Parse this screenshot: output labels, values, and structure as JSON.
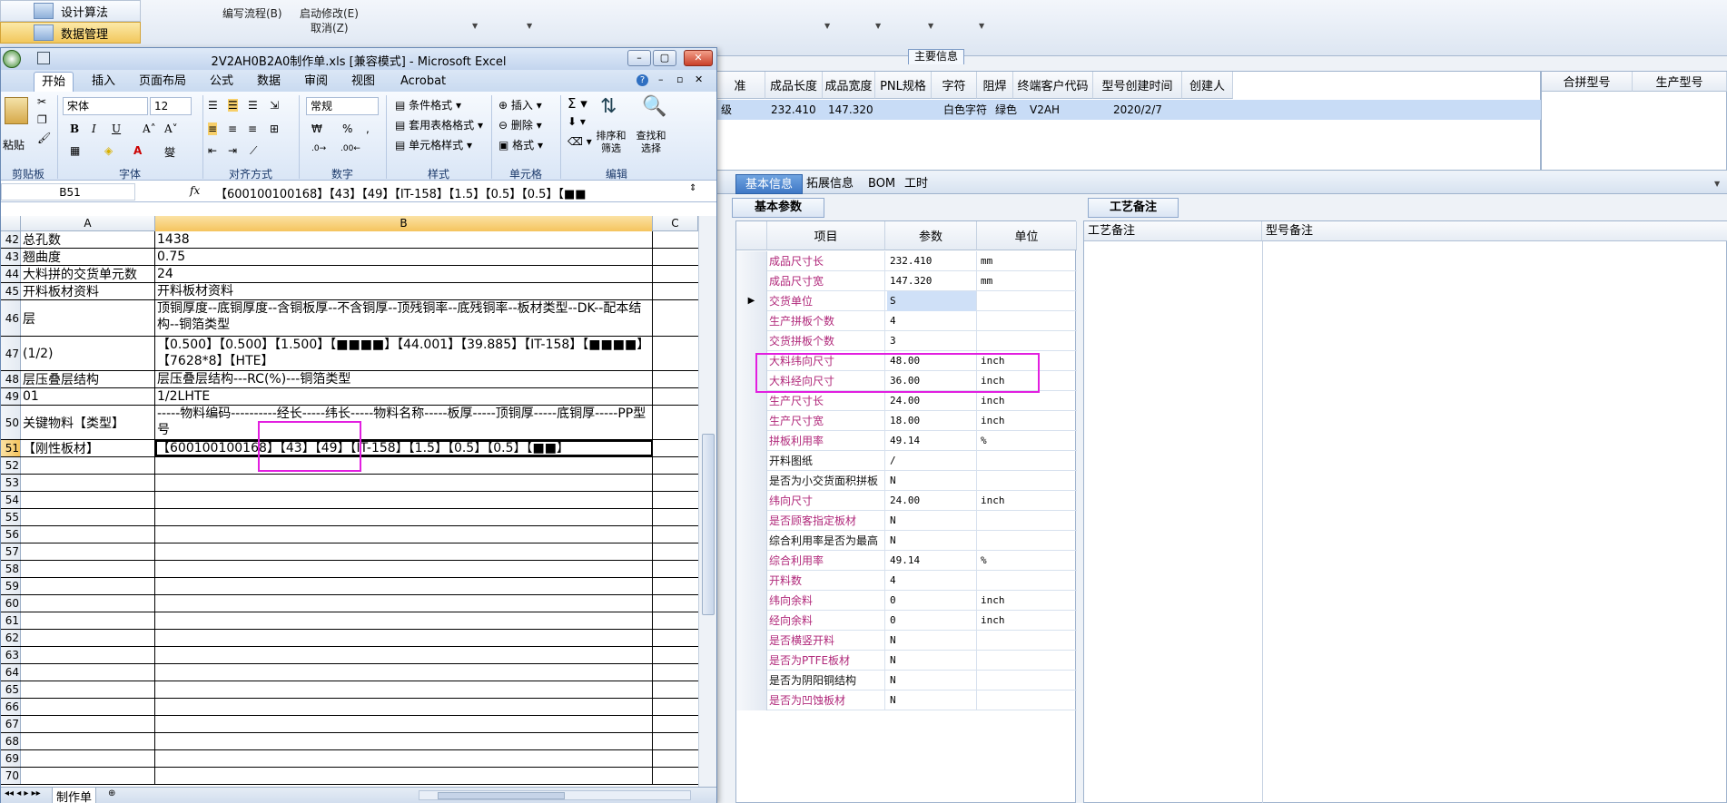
{
  "bg_app": {
    "side_items": [
      {
        "label": "设计算法"
      },
      {
        "label": "数据管理"
      }
    ],
    "ribbon": {
      "edit_flow": "编写流程(B)",
      "start_modify": "启动修改(E)",
      "cancel": "取消(Z)"
    },
    "main_info_tab": "主要信息",
    "top_grid": {
      "headers": [
        "准",
        "成品长度",
        "成品宽度",
        "PNL规格",
        "字符",
        "阻焊",
        "终端客户代码",
        "型号创建时间",
        "创建人"
      ],
      "row": [
        "级",
        "232.410",
        "147.320",
        "",
        "白色字符",
        "绿色",
        "V2AH",
        "2020/2/7",
        ""
      ]
    },
    "right_grid": {
      "headers": [
        "合拼型号",
        "生产型号"
      ]
    },
    "tabs": [
      "基本信息",
      "拓展信息",
      "BOM",
      "工时"
    ],
    "param_tab": "基本参数",
    "remark_tab": "工艺备注",
    "param_headers": [
      "项目",
      "参数",
      "单位"
    ],
    "params": [
      {
        "name": "成品尺寸长",
        "value": "232.410",
        "unit": "mm",
        "c": "mag"
      },
      {
        "name": "成品尺寸宽",
        "value": "147.320",
        "unit": "mm",
        "c": "mag"
      },
      {
        "name": "交货单位",
        "value": "S",
        "unit": "",
        "c": "mag"
      },
      {
        "name": "生产拼板个数",
        "value": "4",
        "unit": "",
        "c": "mag"
      },
      {
        "name": "交货拼板个数",
        "value": "3",
        "unit": "",
        "c": "mag"
      },
      {
        "name": "大料纬向尺寸",
        "value": "48.00",
        "unit": "inch",
        "c": "mag"
      },
      {
        "name": "大料经向尺寸",
        "value": "36.00",
        "unit": "inch",
        "c": "mag"
      },
      {
        "name": "生产尺寸长",
        "value": "24.00",
        "unit": "inch",
        "c": "mag"
      },
      {
        "name": "生产尺寸宽",
        "value": "18.00",
        "unit": "inch",
        "c": "mag"
      },
      {
        "name": "拼板利用率",
        "value": "49.14",
        "unit": "%",
        "c": "mag"
      },
      {
        "name": "开料图纸",
        "value": "/",
        "unit": "",
        "c": "blk"
      },
      {
        "name": "是否为小交货面积拼板",
        "value": "N",
        "unit": "",
        "c": "blk"
      },
      {
        "name": "纬向尺寸",
        "value": "24.00",
        "unit": "inch",
        "c": "mag"
      },
      {
        "name": "是否顾客指定板材",
        "value": "N",
        "unit": "",
        "c": "mag"
      },
      {
        "name": "综合利用率是否为最高",
        "value": "N",
        "unit": "",
        "c": "blk"
      },
      {
        "name": "综合利用率",
        "value": "49.14",
        "unit": "%",
        "c": "mag"
      },
      {
        "name": "开料数",
        "value": "4",
        "unit": "",
        "c": "mag"
      },
      {
        "name": "纬向余料",
        "value": "0",
        "unit": "inch",
        "c": "mag"
      },
      {
        "name": "经向余料",
        "value": "0",
        "unit": "inch",
        "c": "mag"
      },
      {
        "name": "是否横竖开料",
        "value": "N",
        "unit": "",
        "c": "mag"
      },
      {
        "name": "是否为PTFE板材",
        "value": "N",
        "unit": "",
        "c": "mag"
      },
      {
        "name": "是否为阴阳铜结构",
        "value": "N",
        "unit": "",
        "c": "blk"
      },
      {
        "name": "是否为凹蚀板材",
        "value": "N",
        "unit": "",
        "c": "mag"
      }
    ],
    "remark_headers": [
      "工艺备注",
      "型号备注"
    ]
  },
  "excel": {
    "title": "2V2AH0B2A0制作单.xls [兼容模式] - Microsoft Excel",
    "tabs": [
      "开始",
      "插入",
      "页面布局",
      "公式",
      "数据",
      "审阅",
      "视图",
      "Acrobat"
    ],
    "font_name": "宋体",
    "font_size": "12",
    "number_format": "常规",
    "groups": [
      "剪贴板",
      "字体",
      "对齐方式",
      "数字",
      "样式",
      "单元格",
      "编辑"
    ],
    "paste": "粘贴",
    "style_btns": [
      "条件格式",
      "套用表格格式",
      "单元格样式"
    ],
    "cell_btns": [
      "插入",
      "删除",
      "格式"
    ],
    "edit_btns": [
      "排序和筛选",
      "查找和选择"
    ],
    "name_box": "B51",
    "formula": "【600100100168】【43】【49】【IT-158】【1.5】【0.5】【0.5】【■■",
    "col_headers": [
      "A",
      "B",
      "C"
    ],
    "rows": [
      {
        "n": "42",
        "a": "总孔数",
        "b": "1438",
        "h": 19
      },
      {
        "n": "43",
        "a": "翘曲度",
        "b": "0.75",
        "h": 19
      },
      {
        "n": "44",
        "a": "大料拼的交货单元数",
        "b": "24",
        "h": 19
      },
      {
        "n": "45",
        "a": "开料板材资料",
        "b": "开料板材资料",
        "h": 19
      },
      {
        "n": "46",
        "a": "层",
        "b": "顶铜厚度--底铜厚度--含铜板厚--不含铜厚--顶残铜率--底残铜率--板材类型--DK--配本结构--铜箔类型",
        "h": 40
      },
      {
        "n": "47",
        "a": "(1/2)",
        "b": "【0.500】【0.500】【1.500】【■■■■】【44.001】【39.885】【IT-158】【■■■■】【7628*8】【HTE】",
        "h": 38
      },
      {
        "n": "48",
        "a": "层压叠层结构",
        "b": "层压叠层结构---RC(%)---铜箔类型",
        "h": 19
      },
      {
        "n": "49",
        "a": "01",
        "b": "1/2LHTE",
        "h": 19
      },
      {
        "n": "50",
        "a": "关键物料【类型】",
        "b": "-----物料编码----------经长-----纬长-----物料名称-----板厚-----顶铜厚-----底铜厚-----PP型号",
        "h": 38
      },
      {
        "n": "51",
        "a": "【刚性板材】",
        "b": "【600100100168】【43】【49】【IT-158】【1.5】【0.5】【0.5】【■■】",
        "h": 19
      },
      {
        "n": "52",
        "a": "",
        "b": "",
        "h": 19
      },
      {
        "n": "53",
        "a": "",
        "b": "",
        "h": 19
      },
      {
        "n": "54",
        "a": "",
        "b": "",
        "h": 19
      },
      {
        "n": "55",
        "a": "",
        "b": "",
        "h": 19
      },
      {
        "n": "56",
        "a": "",
        "b": "",
        "h": 19
      },
      {
        "n": "57",
        "a": "",
        "b": "",
        "h": 19
      },
      {
        "n": "58",
        "a": "",
        "b": "",
        "h": 19
      },
      {
        "n": "59",
        "a": "",
        "b": "",
        "h": 19
      },
      {
        "n": "60",
        "a": "",
        "b": "",
        "h": 19
      },
      {
        "n": "61",
        "a": "",
        "b": "",
        "h": 19
      },
      {
        "n": "62",
        "a": "",
        "b": "",
        "h": 19
      },
      {
        "n": "63",
        "a": "",
        "b": "",
        "h": 19
      },
      {
        "n": "64",
        "a": "",
        "b": "",
        "h": 19
      },
      {
        "n": "65",
        "a": "",
        "b": "",
        "h": 19
      },
      {
        "n": "66",
        "a": "",
        "b": "",
        "h": 19
      },
      {
        "n": "67",
        "a": "",
        "b": "",
        "h": 19
      },
      {
        "n": "68",
        "a": "",
        "b": "",
        "h": 19
      },
      {
        "n": "69",
        "a": "",
        "b": "",
        "h": 19
      },
      {
        "n": "70",
        "a": "",
        "b": "",
        "h": 19
      }
    ],
    "sheet_tab": "制作单"
  },
  "colors": {
    "highlight": "#e21fe0",
    "magenta_label": "#b0287a",
    "selected_row": "#c8dcf6",
    "accent_tab": "#3f78c6"
  }
}
